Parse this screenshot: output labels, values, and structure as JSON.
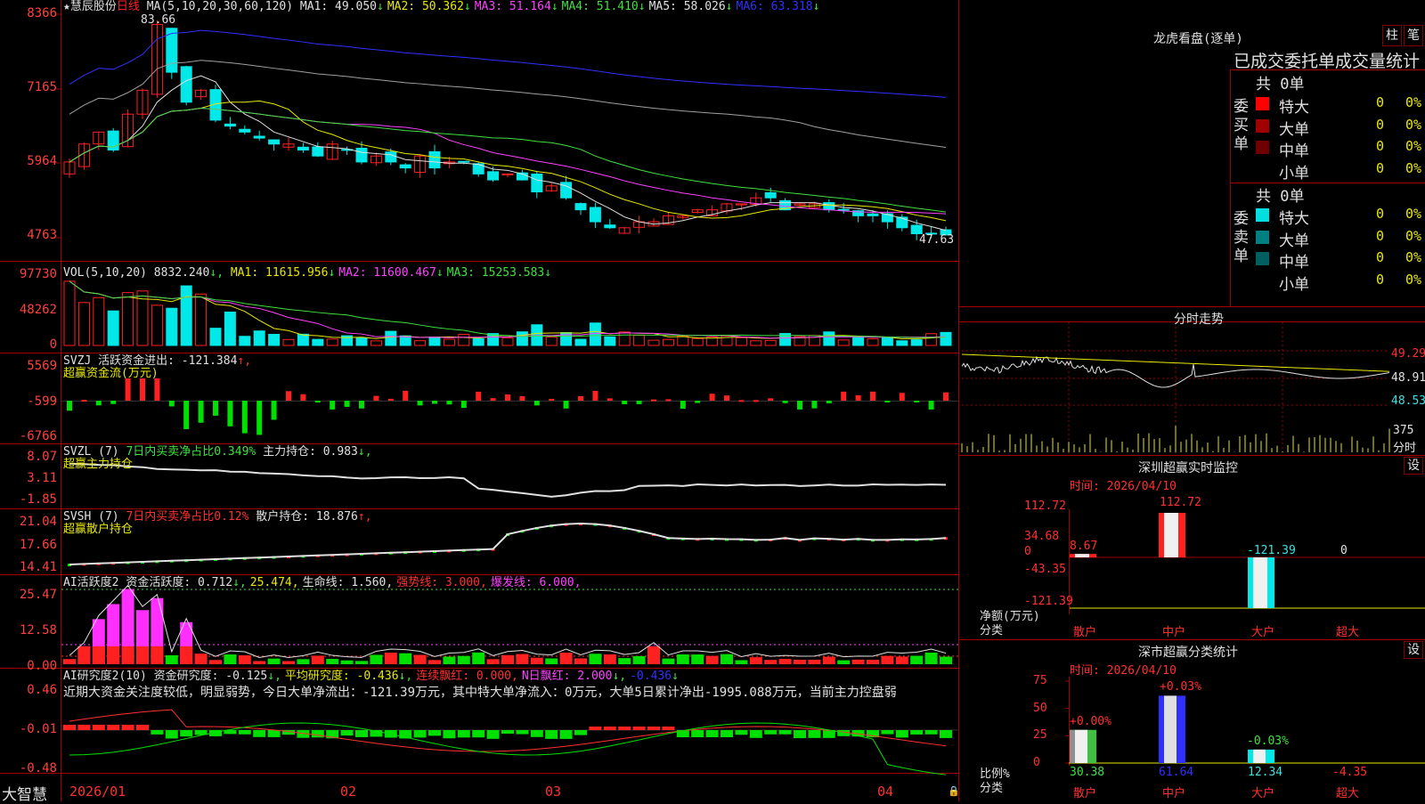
{
  "stock": {
    "star": "★",
    "name": "慧辰股份",
    "period": "日线"
  },
  "kline": {
    "ma_header": "MA(5,10,20,30,60,120)",
    "mas": [
      {
        "label": "MA1: 49.050",
        "arrow": "↓",
        "color": "#e0e0e0"
      },
      {
        "label": "MA2: 50.362",
        "arrow": "↓",
        "color": "#e8e800"
      },
      {
        "label": "MA3: 51.164",
        "arrow": "↓",
        "color": "#ff40ff"
      },
      {
        "label": "MA4: 51.410",
        "arrow": "↓",
        "color": "#40e040"
      },
      {
        "label": "MA5: 58.026",
        "arrow": "↓",
        "color": "#e0e0e0"
      },
      {
        "label": "MA6: 63.318",
        "arrow": "↓",
        "color": "#3030ff"
      }
    ],
    "yticks": [
      "8366",
      "7165",
      "5964",
      "4763"
    ],
    "high_label": "83.66",
    "low_label": "47.63",
    "high_value": 83.66,
    "low_value": 47.63
  },
  "vol": {
    "header": "VOL(5,10,20)",
    "value": "8832.240",
    "items": [
      {
        "label": "MA1: 11615.956",
        "arrow": "↓",
        "color": "#e8e800"
      },
      {
        "label": "MA2: 11600.467",
        "arrow": "↓",
        "color": "#ff40ff"
      },
      {
        "label": "MA3: 15253.583",
        "arrow": "↓",
        "color": "#40e040"
      }
    ],
    "yticks": [
      "97730",
      "48262",
      "0"
    ]
  },
  "svzj": {
    "header": "SVZJ  活跃资金进出: -121.384",
    "arrow": "↑,",
    "subtitle": "超赢资金流(万元)",
    "yticks": [
      "5569",
      "-599",
      "-6766"
    ]
  },
  "svzl": {
    "header": "SVZL (7)",
    "green_text": "7日内买卖净占比0.349%",
    "white_text": "主力持仓: 0.983",
    "arrow": "↓,",
    "subtitle": "超赢主力持仓",
    "yticks": [
      "8.07",
      "3.11",
      "-1.85"
    ]
  },
  "svsh": {
    "header": "SVSH (7)",
    "red_text": "7日内买卖净占比0.12%",
    "white_text": "散户持仓: 18.876",
    "arrow": "↑,",
    "subtitle": "超赢散户持仓",
    "yticks": [
      "21.04",
      "17.66",
      "14.41"
    ]
  },
  "ai_active": {
    "header": "AI活跃度2",
    "items": [
      {
        "label": "资金活跃度: 0.712",
        "arrow": "↓,",
        "color": "#e0e0e0"
      },
      {
        "label": "25.474,",
        "arrow": "",
        "color": "#e8e800"
      },
      {
        "label": "生命线: 1.560,",
        "arrow": "",
        "color": "#e0e0e0"
      },
      {
        "label": "强势线: 3.000,",
        "arrow": "",
        "color": "#ff3030"
      },
      {
        "label": "爆发线: 6.000,",
        "arrow": "",
        "color": "#ff40ff"
      }
    ],
    "yticks": [
      "25.47",
      "12.58",
      "0.00"
    ]
  },
  "ai_research": {
    "header": "AI研究度2(10)",
    "items": [
      {
        "label": "资金研究度: -0.125",
        "arrow": "↓,",
        "color": "#e0e0e0"
      },
      {
        "label": "平均研究度: -0.436",
        "arrow": "↓,",
        "color": "#e8e800"
      },
      {
        "label": "连续飘红: 0.000,",
        "arrow": "",
        "color": "#ff3030"
      },
      {
        "label": "N日飘红: 2.000",
        "arrow": "↓,",
        "color": "#ff40ff"
      },
      {
        "label": "-0.436",
        "arrow": "↓",
        "color": "#3030ff"
      }
    ],
    "comment": "近期大资金关注度较低，明显弱势，今日大单净流出：-121.39万元，其中特大单净流入：0万元，大单5日累计净出-1995.088万元，当前主力控盘弱",
    "yticks": [
      "0.46",
      "-0.01",
      "-0.48"
    ]
  },
  "xaxis": {
    "brand": "大智慧",
    "labels": [
      "2026/01",
      "02",
      "03",
      "04"
    ]
  },
  "right": {
    "longhu_title": "龙虎看盘(逐单)",
    "btn_zhu": "柱",
    "btn_bi": "笔",
    "stats_title": "已成交委托单成交量统计",
    "buy": {
      "side_label": "委买单",
      "total": "共 0单",
      "rows": [
        {
          "name": "特大",
          "count": "0",
          "pct": "0%",
          "color": "#ff0000"
        },
        {
          "name": "大单",
          "count": "0",
          "pct": "0%",
          "color": "#a00000"
        },
        {
          "name": "中单",
          "count": "0",
          "pct": "0%",
          "color": "#700000"
        },
        {
          "name": "小单",
          "count": "0",
          "pct": "0%",
          "color": ""
        }
      ]
    },
    "sell": {
      "side_label": "委卖单",
      "total": "共 0单",
      "rows": [
        {
          "name": "特大",
          "count": "0",
          "pct": "0%",
          "color": "#00e0e0"
        },
        {
          "name": "大单",
          "count": "0",
          "pct": "0%",
          "color": "#008080"
        },
        {
          "name": "中单",
          "count": "0",
          "pct": "0%",
          "color": "#006060"
        },
        {
          "name": "小单",
          "count": "0",
          "pct": "0%",
          "color": ""
        }
      ]
    },
    "intraday": {
      "title": "分时走势",
      "yticks": [
        "49.29",
        "48.91",
        "48.53"
      ],
      "vol_label": "375",
      "vol_caption": "分时"
    },
    "monitor": {
      "title": "深圳超赢实时监控",
      "btn": "设",
      "time": "时间: 2026/04/10",
      "yticks": [
        "112.72",
        "34.68",
        "0",
        "-43.35",
        "-121.39"
      ],
      "bar_labels": [
        "8.67",
        "112.72",
        "-121.39",
        "0"
      ],
      "bar_values": [
        8.67,
        112.72,
        -121.39,
        0
      ],
      "ylabel": "净额(万元)",
      "xlabel": "分类",
      "categories": [
        "散户",
        "中户",
        "大户",
        "超大"
      ]
    },
    "classify": {
      "title": "深市超赢分类统计",
      "btn": "设",
      "time": "时间: 2026/04/10",
      "yticks": [
        "75",
        "50",
        "25",
        "0"
      ],
      "pct_labels": [
        "+0.00%",
        "+0.03%",
        "-0.03%"
      ],
      "values": [
        "30.38",
        "61.64",
        "12.34",
        "-4.35"
      ],
      "values_num": [
        30.38,
        61.64,
        12.34,
        -4.35
      ],
      "ylabel": "比例%",
      "xlabel": "分类",
      "categories": [
        "散户",
        "中户",
        "大户",
        "超大"
      ]
    }
  }
}
